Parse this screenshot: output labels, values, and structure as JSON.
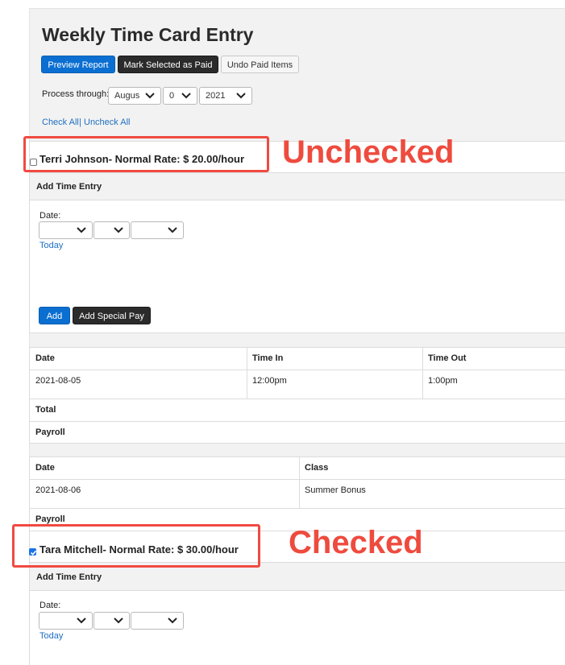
{
  "page": {
    "title": "Weekly Time Card Entry"
  },
  "toolbar": {
    "preview_label": "Preview Report",
    "mark_paid_label": "Mark Selected as Paid",
    "undo_paid_label": "Undo Paid Items"
  },
  "process": {
    "label": "Process through:",
    "month": "Augus",
    "day": "0",
    "year": "2021"
  },
  "check_links": {
    "check_all": "Check All",
    "separator": "|",
    "uncheck_all": "Uncheck All"
  },
  "employees": [
    {
      "name": "Terri Johnson- Normal Rate: $ 20.00/hour",
      "checked": false,
      "add_entry_title": "Add Time Entry",
      "date_label": "Date:",
      "today_label": "Today",
      "add_label": "Add",
      "add_special_label": "Add Special Pay",
      "time_table": {
        "headers": [
          "Date",
          "Time In",
          "Time Out"
        ],
        "rows": [
          [
            "2021-08-05",
            "12:00pm",
            "1:00pm"
          ]
        ],
        "total_label": "Total",
        "payroll_label": "Payroll"
      },
      "special_table": {
        "headers": [
          "Date",
          "Class"
        ],
        "rows": [
          [
            "2021-08-06",
            "Summer Bonus"
          ]
        ],
        "payroll_label": "Payroll"
      }
    },
    {
      "name": "Tara Mitchell- Normal Rate: $ 30.00/hour",
      "checked": true,
      "add_entry_title": "Add Time Entry",
      "date_label": "Date:",
      "today_label": "Today"
    }
  ],
  "annotations": {
    "unchecked": "Unchecked",
    "checked": "Checked"
  },
  "colors": {
    "primary": "#0b6fd1",
    "dark": "#2b2b2b",
    "annotation": "#f04a41",
    "link": "#1f6fc1"
  }
}
